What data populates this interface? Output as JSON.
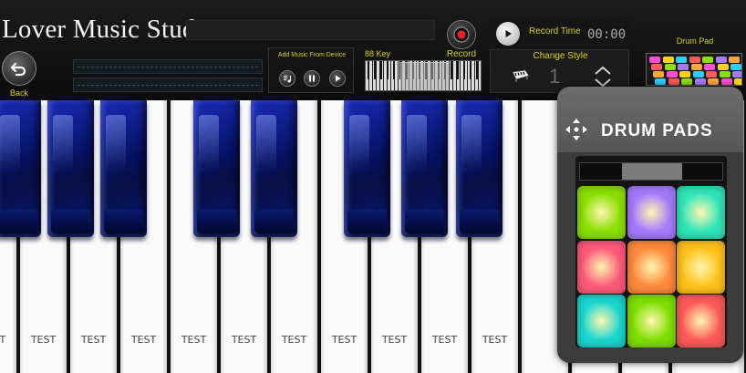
{
  "app": {
    "title": "Lover Music Studio"
  },
  "toolbar": {
    "back_label": "Back",
    "add_music_label": "Add Music From Device",
    "key_range_label": "88 Key",
    "record_label": "Record",
    "record_time_label": "Record Time",
    "record_time_value": "00:00",
    "change_style_label": "Change Style",
    "style_number": "1",
    "drum_pad_label": "Drum Pad"
  },
  "keyboard": {
    "white_key_label": "TEST"
  },
  "drum_pads": {
    "title": "DRUM PADS",
    "pad_colors": [
      "#8be000",
      "#a77aff",
      "#2fe6b8",
      "#ff5a7a",
      "#ff8a3a",
      "#ffc21a",
      "#1ad7d0",
      "#7fe000",
      "#ff5a5a"
    ]
  },
  "colors": {
    "accent_label": "#d7d11a",
    "black_key": "#0a1a8c",
    "record_red": "#e5202a"
  },
  "icons": {
    "back": "back-arrow-icon",
    "record": "record-icon",
    "play": "play-icon",
    "pause": "pause-icon",
    "add_music": "music-note-icon",
    "style_piano": "piano-icon",
    "style_switch": "up-down-arrow-icon",
    "move": "move-arrows-icon"
  }
}
